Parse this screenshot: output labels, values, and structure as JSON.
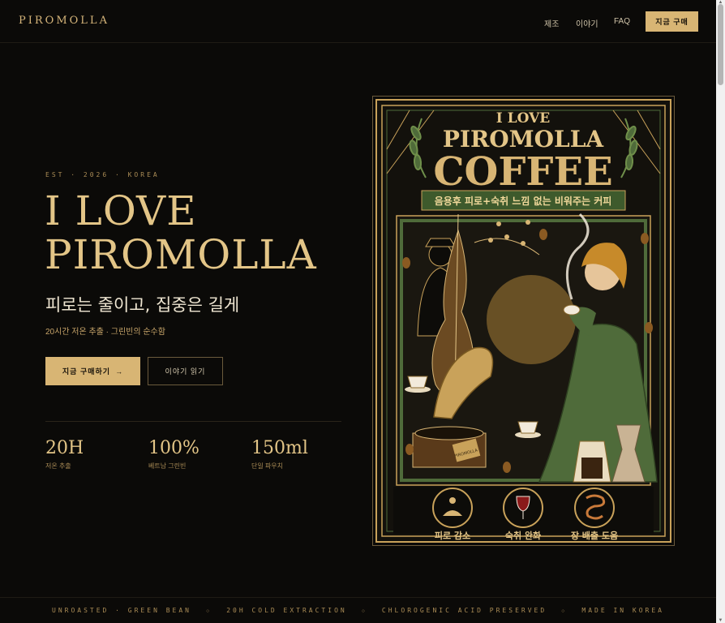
{
  "brand": "PIROMOLLA",
  "nav": {
    "made": "제조",
    "story": "이야기",
    "faq": "FAQ",
    "buy": "지금 구매"
  },
  "hero": {
    "eyebrow": "EST · 2026 · KOREA",
    "title_line1": "I LOVE",
    "title_line2": "PIROMOLLA",
    "subtitle": "피로는 줄이고, 집중은 길게",
    "note": "20시간 저온 추출 · 그린빈의 순수함",
    "primary_cta": "지금 구매하기",
    "primary_arrow": "→",
    "secondary_cta": "이야기 읽기"
  },
  "stats": [
    {
      "value": "20H",
      "label": "저온 추출"
    },
    {
      "value": "100%",
      "label": "베트남 그린빈"
    },
    {
      "value": "150ml",
      "label": "단일 파우치"
    }
  ],
  "poster": {
    "line1": "I LOVE",
    "line2": "PIROMOLLA",
    "line3": "COFFEE",
    "banner": "음용후 피로+숙취 느낌 없는 비워주는 커피",
    "badges": [
      "피로 감소",
      "숙취 완화",
      "장 배출 도움"
    ],
    "gramophone_label": "PIROMOLLA"
  },
  "marquee": [
    "UNROASTED · GREEN BEAN",
    "20H COLD EXTRACTION",
    "CHLOROGENIC ACID PRESERVED",
    "MADE IN KOREA"
  ],
  "colors": {
    "gold": "#d8b574",
    "green": "#4f6b3a",
    "background": "#0b0a08"
  }
}
